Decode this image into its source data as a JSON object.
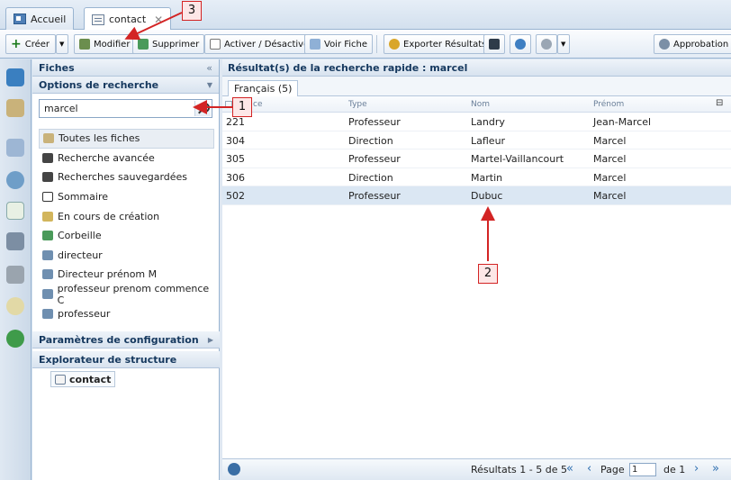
{
  "tabs": [
    {
      "label": "Accueil",
      "icon": "home-icon"
    },
    {
      "label": "contact",
      "icon": "document-icon",
      "close": "✕"
    }
  ],
  "toolbar": {
    "create": "Créer",
    "modify": "Modifier",
    "delete": "Supprimer",
    "toggle": "Activer / Désactiver",
    "view": "Voir Fiche",
    "export": "Exporter Résultats",
    "approval": "Approbation"
  },
  "sidebar": {
    "title": "Fiches",
    "collapse": "«",
    "search_section": "Options de recherche",
    "search_value": "marcel",
    "items": [
      {
        "label": "Toutes les fiches",
        "icon": "cards-icon"
      },
      {
        "label": "Recherche avancée",
        "icon": "binoculars-icon"
      },
      {
        "label": "Recherches sauvegardées",
        "icon": "binoculars-saved-icon"
      },
      {
        "label": "Sommaire",
        "icon": "sum-icon"
      },
      {
        "label": "En cours de création",
        "icon": "draft-icon"
      },
      {
        "label": "Corbeille",
        "icon": "trash-icon"
      },
      {
        "label": "directeur",
        "icon": "saved-search-icon"
      },
      {
        "label": "Directeur prénom M",
        "icon": "saved-search-icon"
      },
      {
        "label": "professeur prenom commence C",
        "icon": "saved-search-icon"
      },
      {
        "label": "professeur",
        "icon": "saved-search-icon"
      }
    ],
    "config_section": "Paramètres de configuration",
    "structure_section": "Explorateur de structure",
    "structure_node": "contact"
  },
  "results": {
    "title": "Résultat(s) de la recherche rapide : marcel",
    "lang_tab": "Français (5)",
    "columns": [
      "Type",
      "Nom",
      "Prénom"
    ],
    "first_column_partial": "ce",
    "rows": [
      {
        "id": "221",
        "type": "Professeur",
        "nom": "Landry",
        "prenom": "Jean-Marcel"
      },
      {
        "id": "304",
        "type": "Direction",
        "nom": "Lafleur",
        "prenom": "Marcel"
      },
      {
        "id": "305",
        "type": "Professeur",
        "nom": "Martel-Vaillancourt",
        "prenom": "Marcel"
      },
      {
        "id": "306",
        "type": "Direction",
        "nom": "Martin",
        "prenom": "Marcel"
      },
      {
        "id": "502",
        "type": "Professeur",
        "nom": "Dubuc",
        "prenom": "Marcel"
      }
    ],
    "status": "Résultats 1 - 5 de 5",
    "page_label": "Page",
    "page_value": "1",
    "page_of": "de 1"
  },
  "annotations": {
    "callout_1": "1",
    "callout_2": "2",
    "callout_3": "3",
    "color": "#d32424"
  }
}
